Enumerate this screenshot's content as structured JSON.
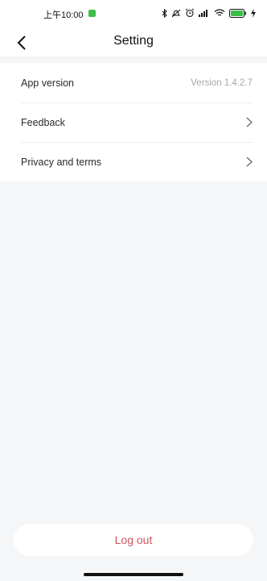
{
  "status_bar": {
    "time": "上午10:00",
    "battery_level": "100"
  },
  "header": {
    "title": "Setting",
    "back_icon": "chevron-left-icon"
  },
  "settings": {
    "items": [
      {
        "label": "App version",
        "value": "Version 1.4.2.7"
      },
      {
        "label": "Feedback",
        "icon": "chevron-right-icon"
      },
      {
        "label": "Privacy and terms",
        "icon": "chevron-right-icon"
      }
    ]
  },
  "footer": {
    "logout_label": "Log out"
  },
  "colors": {
    "background": "#f5f6f8",
    "logout_text": "#c9555a",
    "status_green": "#3bbf4a"
  }
}
